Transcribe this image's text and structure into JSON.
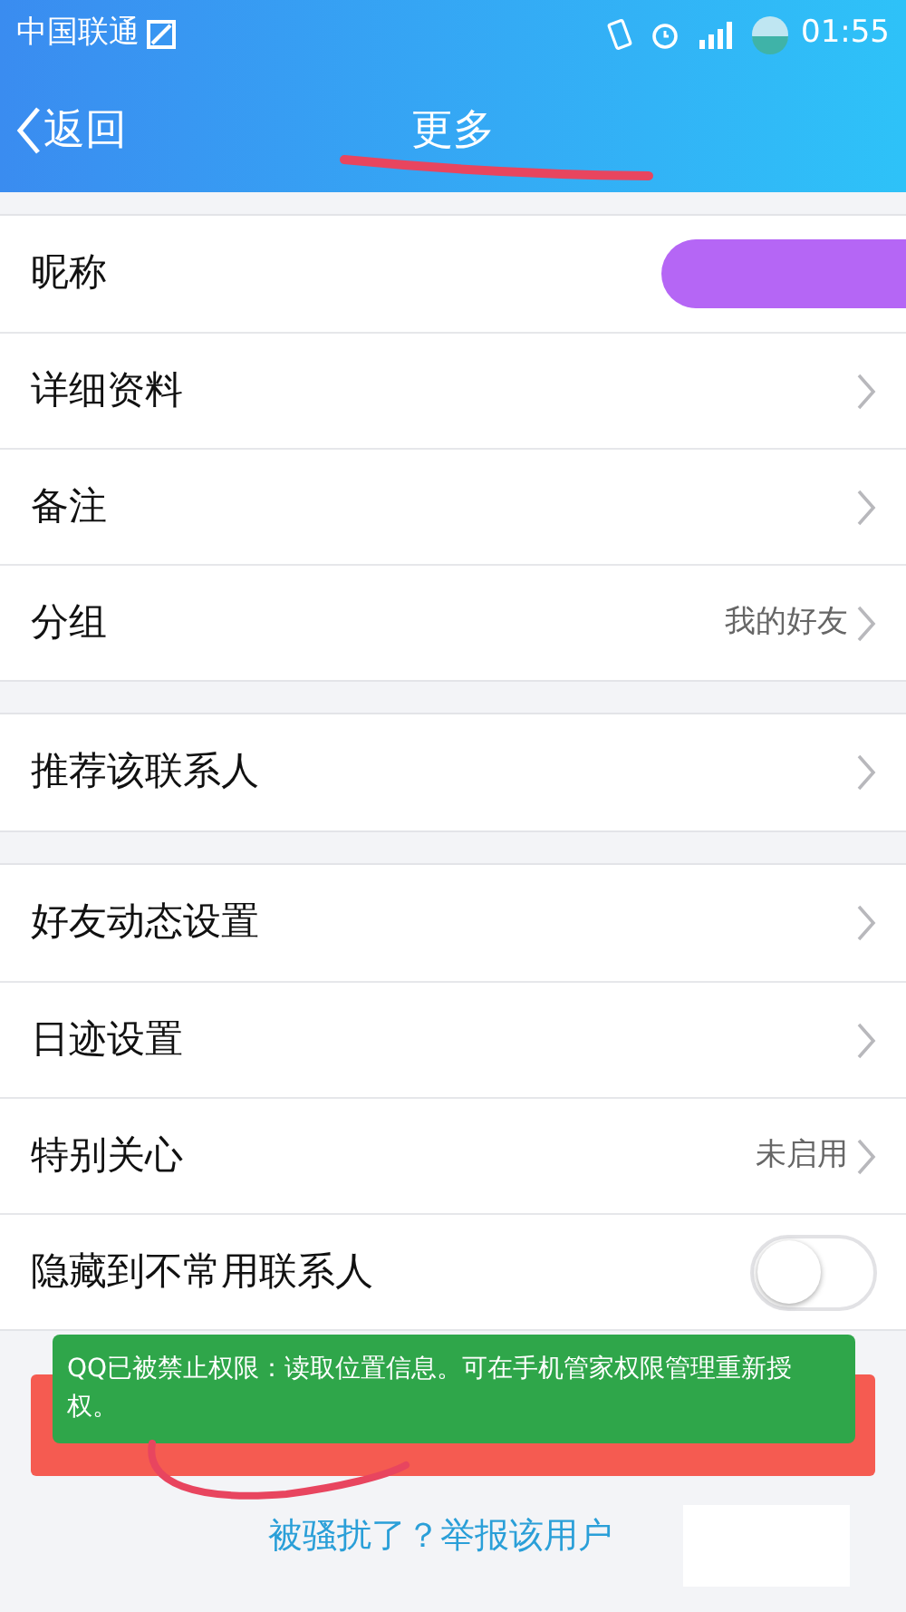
{
  "status_bar": {
    "carrier": "中国联通",
    "time": "01:55"
  },
  "nav": {
    "back": "返回",
    "title": "更多"
  },
  "groups": [
    [
      {
        "kind": "redacted",
        "label": "昵称"
      },
      {
        "kind": "link",
        "label": "详细资料"
      },
      {
        "kind": "link",
        "label": "备注"
      },
      {
        "kind": "link",
        "label": "分组",
        "value": "我的好友"
      }
    ],
    [
      {
        "kind": "link",
        "label": "推荐该联系人"
      }
    ],
    [
      {
        "kind": "link",
        "label": "好友动态设置"
      },
      {
        "kind": "link",
        "label": "日迹设置"
      },
      {
        "kind": "link",
        "label": "特别关心",
        "value": "未启用"
      },
      {
        "kind": "toggle",
        "label": "隐藏到不常用联系人",
        "on": false
      }
    ]
  ],
  "toast": "QQ已被禁止权限：读取位置信息。可在手机管家权限管理重新授权。",
  "report_link": "被骚扰了？举报该用户"
}
